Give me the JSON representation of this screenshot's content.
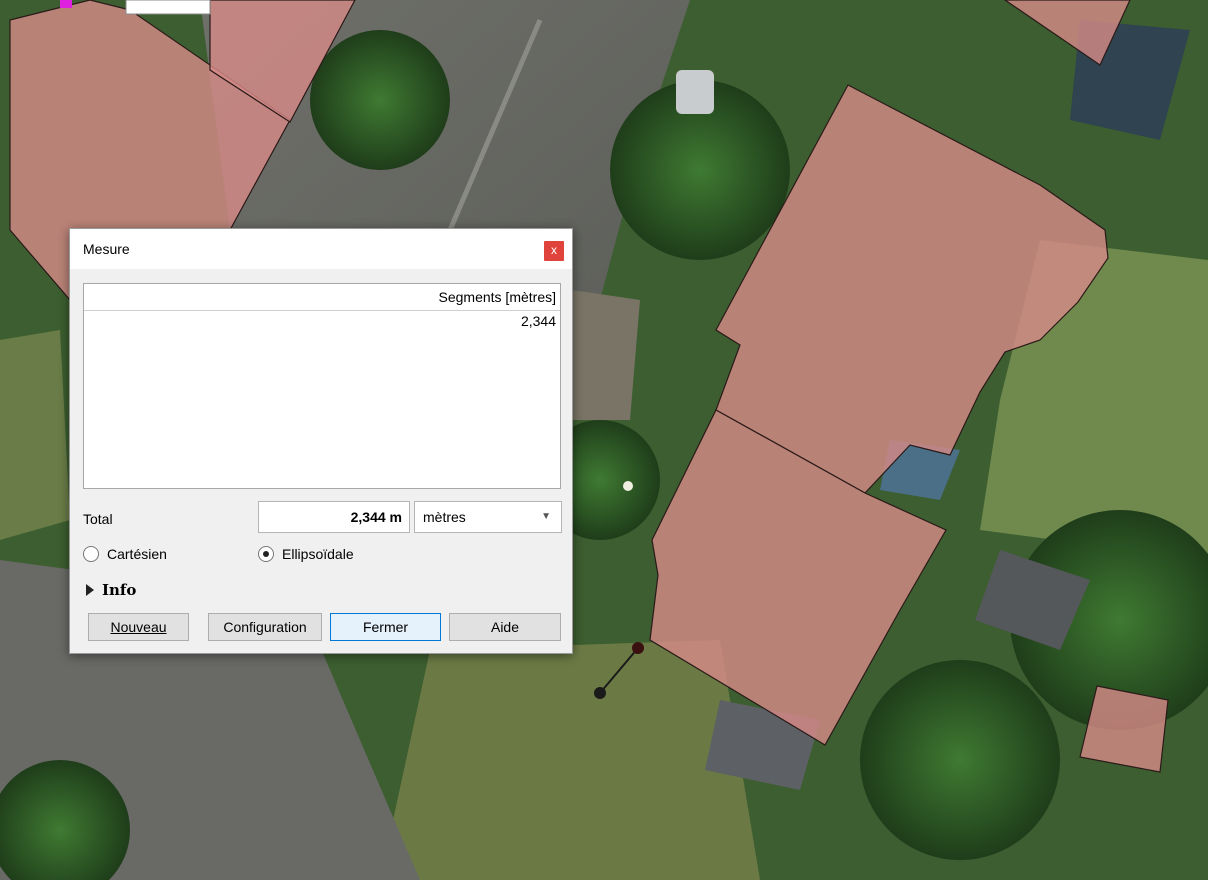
{
  "dialog": {
    "title": "Mesure",
    "close_label": "x",
    "table": {
      "header": "Segments [mètres]",
      "rows": [
        "2,344"
      ]
    },
    "total": {
      "label": "Total",
      "value": "2,344 m",
      "unit": "mètres"
    },
    "modes": {
      "cartesian": {
        "label": "Cartésien",
        "selected": false
      },
      "ellipsoidal": {
        "label": "Ellipsoïdale",
        "selected": true
      }
    },
    "info_label": "Info",
    "buttons": {
      "new": "Nouveau",
      "config": "Configuration",
      "close": "Fermer",
      "help": "Aide"
    }
  },
  "colors": {
    "building_fill": "#d48a88",
    "building_stroke": "#2a1a18",
    "close_button": "#e0433b",
    "primary_border": "#0078d7"
  }
}
